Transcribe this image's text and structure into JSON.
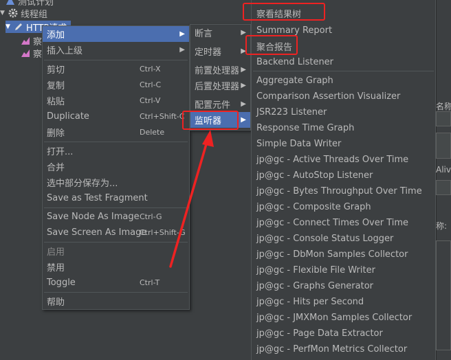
{
  "tree": {
    "items": [
      {
        "label": "测试计划"
      },
      {
        "label": "线程组"
      },
      {
        "label": "HTTP请求"
      },
      {
        "label": "察"
      },
      {
        "label": "察"
      }
    ]
  },
  "context_menu": {
    "items": [
      {
        "label": "添加",
        "shortcut": "",
        "arrow": "▶"
      },
      {
        "label": "插入上级",
        "shortcut": "",
        "arrow": "▶"
      },
      {
        "label": "剪切",
        "shortcut": "Ctrl-X"
      },
      {
        "label": "复制",
        "shortcut": "Ctrl-C"
      },
      {
        "label": "粘贴",
        "shortcut": "Ctrl-V"
      },
      {
        "label": "Duplicate",
        "shortcut": "Ctrl+Shift-C"
      },
      {
        "label": "删除",
        "shortcut": "Delete"
      },
      {
        "label": "打开..."
      },
      {
        "label": "合并"
      },
      {
        "label": "选中部分保存为..."
      },
      {
        "label": "Save as Test Fragment"
      },
      {
        "label": "Save Node As Image",
        "shortcut": "Ctrl-G"
      },
      {
        "label": "Save Screen As Image",
        "shortcut": "Ctrl+Shift-G"
      },
      {
        "label": "启用"
      },
      {
        "label": "禁用"
      },
      {
        "label": "Toggle",
        "shortcut": "Ctrl-T"
      },
      {
        "label": "帮助"
      }
    ]
  },
  "add_submenu": {
    "items": [
      {
        "label": "断言",
        "arrow": "▶"
      },
      {
        "label": "定时器",
        "arrow": "▶"
      },
      {
        "label": "前置处理器",
        "arrow": "▶"
      },
      {
        "label": "后置处理器",
        "arrow": "▶"
      },
      {
        "label": "配置元件",
        "arrow": "▶"
      },
      {
        "label": "监听器",
        "arrow": "▶"
      }
    ]
  },
  "listener_submenu": {
    "items": [
      "察看结果树",
      "Summary Report",
      "聚合报告",
      "Backend Listener",
      "Aggregate Graph",
      "Comparison Assertion Visualizer",
      "JSR223 Listener",
      "Response Time Graph",
      "Simple Data Writer",
      "jp@gc - Active Threads Over Time",
      "jp@gc - AutoStop Listener",
      "jp@gc - Bytes Throughput Over Time",
      "jp@gc - Composite Graph",
      "jp@gc - Connect Times Over Time",
      "jp@gc - Console Status Logger",
      "jp@gc - DbMon Samples Collector",
      "jp@gc - Flexible File Writer",
      "jp@gc - Graphs Generator",
      "jp@gc - Hits per Second",
      "jp@gc - JMXMon Samples Collector",
      "jp@gc - Page Data Extractor",
      "jp@gc - PerfMon Metrics Collector"
    ]
  },
  "right_panel": {
    "name_label": "名称:",
    "alive_label": "Alive",
    "colon_label": "称:"
  },
  "colors": {
    "background": "#3c3f41",
    "selection": "#4b6eaf",
    "annotation": "#ee2222"
  }
}
